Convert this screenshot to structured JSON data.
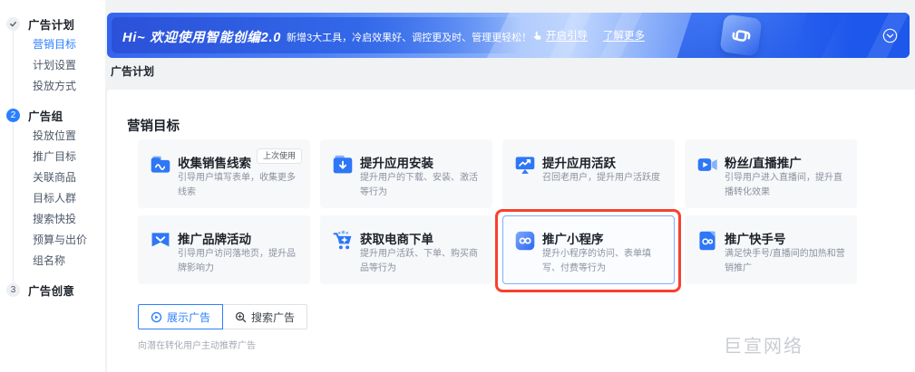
{
  "sidebar": {
    "steps": [
      {
        "badge": "check",
        "state": "done",
        "label": "广告计划",
        "items": [
          {
            "label": "营销目标",
            "active": true
          },
          {
            "label": "计划设置",
            "active": false
          },
          {
            "label": "投放方式",
            "active": false
          }
        ]
      },
      {
        "badge": "2",
        "state": "current",
        "label": "广告组",
        "items": [
          {
            "label": "投放位置",
            "active": false
          },
          {
            "label": "推广目标",
            "active": false
          },
          {
            "label": "关联商品",
            "active": false
          },
          {
            "label": "目标人群",
            "active": false
          },
          {
            "label": "搜索快投",
            "active": false
          },
          {
            "label": "预算与出价",
            "active": false
          },
          {
            "label": "组名称",
            "active": false
          }
        ]
      },
      {
        "badge": "3",
        "state": "todo",
        "label": "广告创意",
        "items": []
      }
    ]
  },
  "banner": {
    "title": "Hi~ 欢迎使用智能创编2.0",
    "subtitle": "新增3大工具，冷启效果好、调控更及时、管理更轻松！",
    "guide_link": "开启引导",
    "more_link": "了解更多",
    "guide_icon": "pointer-hand-icon",
    "logo_icon": "smart-creation-logo",
    "collapse_icon": "chevron-down-circle-icon"
  },
  "breadcrumb": "广告计划",
  "panel": {
    "section_title": "营销目标",
    "cards": [
      {
        "icon": "leads-folder-icon",
        "title": "收集销售线索",
        "badge": "上次使用",
        "desc": "引导用户填写表单，收集更多线索",
        "selected": false,
        "annotated": false
      },
      {
        "icon": "app-install-icon",
        "title": "提升应用安装",
        "badge": "",
        "desc": "提升用户的下载、安装、激活等行为",
        "selected": false,
        "annotated": false
      },
      {
        "icon": "app-active-icon",
        "title": "提升应用活跃",
        "badge": "",
        "desc": "召回老用户，提升用户活跃度",
        "selected": false,
        "annotated": false
      },
      {
        "icon": "live-promo-icon",
        "title": "粉丝/直播推广",
        "badge": "",
        "desc": "引导用户进入直播间，提升直播转化效果",
        "selected": false,
        "annotated": false
      },
      {
        "icon": "brand-campaign-icon",
        "title": "推广品牌活动",
        "badge": "",
        "desc": "引导用户访问落地页，提升品牌影响力",
        "selected": false,
        "annotated": false
      },
      {
        "icon": "ecommerce-order-icon",
        "title": "获取电商下单",
        "badge": "",
        "desc": "提升用户活跃、下单、购买商品等行为",
        "selected": false,
        "annotated": false
      },
      {
        "icon": "miniapp-icon",
        "title": "推广小程序",
        "badge": "",
        "desc": "提升小程序的访问、表单填写、付费等行为",
        "selected": true,
        "annotated": true
      },
      {
        "icon": "kuaishou-account-icon",
        "title": "推广快手号",
        "badge": "",
        "desc": "满足快手号/直播间的加热和营销推广",
        "selected": false,
        "annotated": false
      }
    ],
    "ad_type_tabs": [
      {
        "label": "展示广告",
        "icon": "display-ad-icon",
        "selected": true
      },
      {
        "label": "搜索广告",
        "icon": "search-ad-icon",
        "selected": false
      }
    ],
    "caption": "向潜在转化用户主动推荐广告"
  },
  "watermark": "巨宣网络",
  "colors": {
    "accent": "#2B7FFF",
    "annotation_red": "#F8402E",
    "banner_deep_blue": "#1E57EC",
    "card_bg": "#F7F8FA",
    "selected_card_border": "#7EAEFA"
  }
}
